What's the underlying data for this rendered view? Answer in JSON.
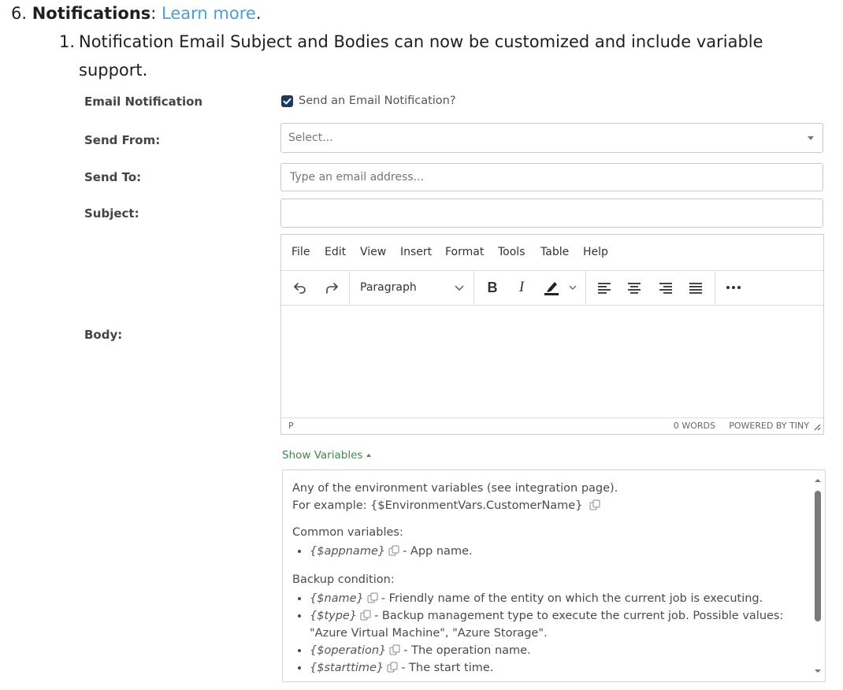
{
  "doc": {
    "item_number": "6.",
    "heading": "Notifications",
    "colon": ":",
    "learn_more": "Learn more",
    "period": ".",
    "sub_number": "1.",
    "sub_text_line1": "Notification Email Subject and Bodies can now be customized and include variable",
    "sub_text_line2": "support."
  },
  "form": {
    "email_notification_label": "Email Notification",
    "email_checkbox_label": "Send an Email Notification?",
    "email_checkbox_checked": true,
    "send_from_label": "Send From:",
    "send_from_value": "Select...",
    "send_to_label": "Send To:",
    "send_to_placeholder": "Type an email address...",
    "subject_label": "Subject:",
    "subject_value": "",
    "body_label": "Body:"
  },
  "editor": {
    "menu": [
      "File",
      "Edit",
      "View",
      "Insert",
      "Format",
      "Tools",
      "Table",
      "Help"
    ],
    "block_format": "Paragraph",
    "status_path": "P",
    "word_count": "0 WORDS",
    "powered_by": "POWERED BY TINY"
  },
  "variables": {
    "toggle_label": "Show Variables",
    "intro_line1": "Any of the environment variables (see integration page).",
    "intro_line2": "For example: {$EnvironmentVars.CustomerName}",
    "common_heading": "Common variables:",
    "common": [
      {
        "code": "{$appname}",
        "desc": "- App name."
      }
    ],
    "backup_heading": "Backup condition:",
    "backup": [
      {
        "code": "{$name}",
        "desc": "- Friendly name of the entity on which the current job is executing."
      },
      {
        "code": "{$type}",
        "desc": "- Backup management type to execute the current job. Possible values:",
        "desc2": "\"Azure Virtual Machine\", \"Azure Storage\"."
      },
      {
        "code": "{$operation}",
        "desc": "- The operation name."
      },
      {
        "code": "{$starttime}",
        "desc": "- The start time."
      }
    ]
  },
  "colors": {
    "link": "#4a9fd6",
    "toggle": "#3a8a4a",
    "checkbox": "#1e3a5f"
  }
}
